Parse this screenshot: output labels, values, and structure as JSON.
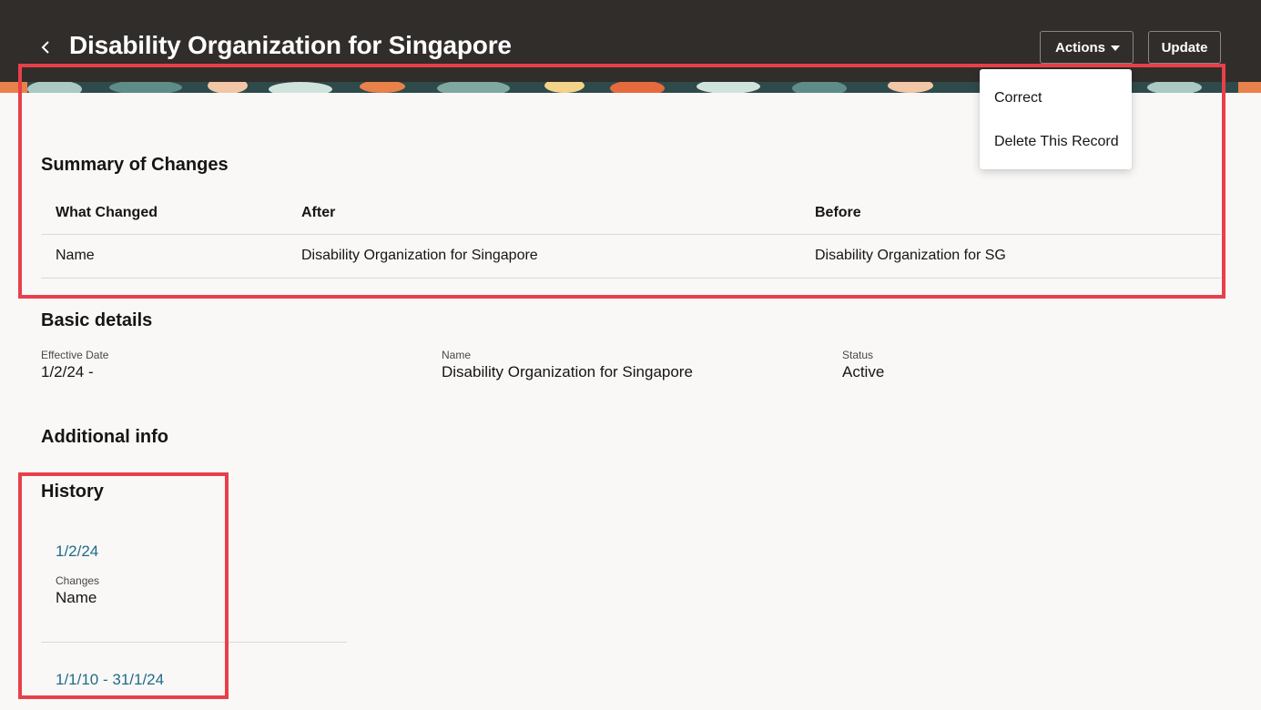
{
  "header": {
    "title": "Disability Organization for Singapore",
    "actions_label": "Actions",
    "update_label": "Update"
  },
  "actions_menu": {
    "items": [
      "Correct",
      "Delete This Record"
    ]
  },
  "summary": {
    "title": "Summary of Changes",
    "columns": [
      "What Changed",
      "After",
      "Before"
    ],
    "rows": [
      [
        "Name",
        "Disability Organization for Singapore",
        "Disability Organization for SG"
      ]
    ]
  },
  "basic_details": {
    "title": "Basic details",
    "fields": [
      {
        "label": "Effective Date",
        "value": "1/2/24 -"
      },
      {
        "label": "Name",
        "value": "Disability Organization for Singapore"
      },
      {
        "label": "Status",
        "value": "Active"
      }
    ]
  },
  "additional_info": {
    "title": "Additional info"
  },
  "history": {
    "title": "History",
    "entries": [
      {
        "date": "1/2/24",
        "changes_label": "Changes",
        "changes_value": "Name"
      },
      {
        "date": "1/1/10 - 31/1/24"
      }
    ]
  },
  "colors": {
    "header_bg": "#312d2a",
    "page_bg": "#f9f8f6",
    "link": "#1f6b8a",
    "highlight": "#e8404a"
  }
}
